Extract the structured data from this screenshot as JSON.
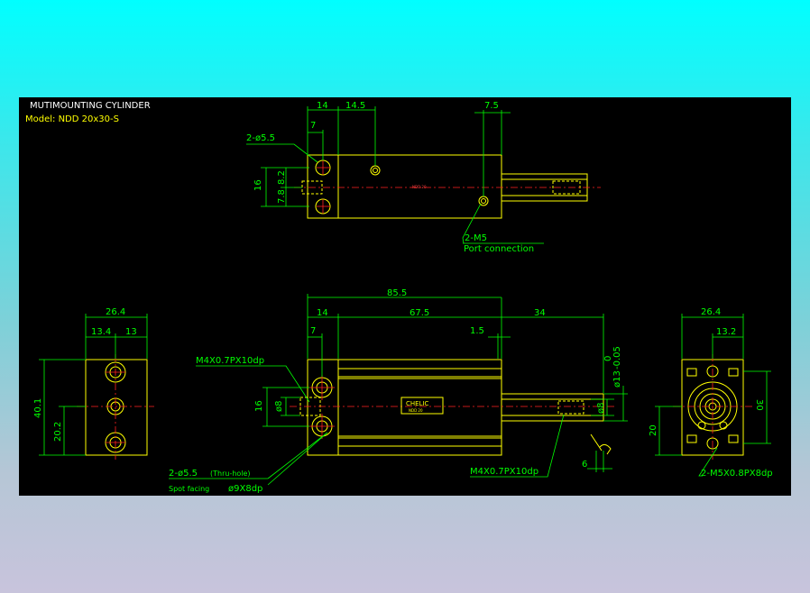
{
  "title": "MUTIMOUNTING CYLINDER",
  "model": "Model: NDD 20x30-S",
  "top_view": {
    "dims": {
      "d14": "14",
      "d14_5": "14.5",
      "d7": "7",
      "d7_5": "7.5",
      "d16": "16",
      "d7_8": "7.8",
      "d8_2": "8.2"
    },
    "holes_label": "2-ø5.5",
    "port_label": "2-M5",
    "port_desc": "Port connection",
    "body_text": "NDD 20"
  },
  "left_view": {
    "dims": {
      "w26_4": "26.4",
      "d13_4": "13.4",
      "d13": "13",
      "h40_1": "40.1",
      "h20_2": "20.2"
    }
  },
  "front_view": {
    "dims": {
      "d85_5": "85.5",
      "d14": "14",
      "d67_5": "67.5",
      "d34": "34",
      "d7": "7",
      "d1_5": "1.5",
      "d16": "16",
      "d8": "ø8",
      "d8rod": "ø8",
      "d6": "6",
      "d13tol": "ø13",
      "tol_top": "0",
      "tol_bot": "-0.05"
    },
    "thread_left": "M4X0.7PX10dp",
    "thread_right": "M4X0.7PX10dp",
    "holes_label": "2-ø5.5",
    "holes_note": "(Thru-hole)",
    "spot": "Spot facing",
    "spot_dim": "ø9X8dp",
    "brand": "CHELIC",
    "plate_line": "NDD 20"
  },
  "right_view": {
    "dims": {
      "w26_4": "26.4",
      "d13_2": "13.2",
      "h30": "30",
      "h20": "20"
    },
    "thread": "2-M5X0.8PX8dp"
  }
}
